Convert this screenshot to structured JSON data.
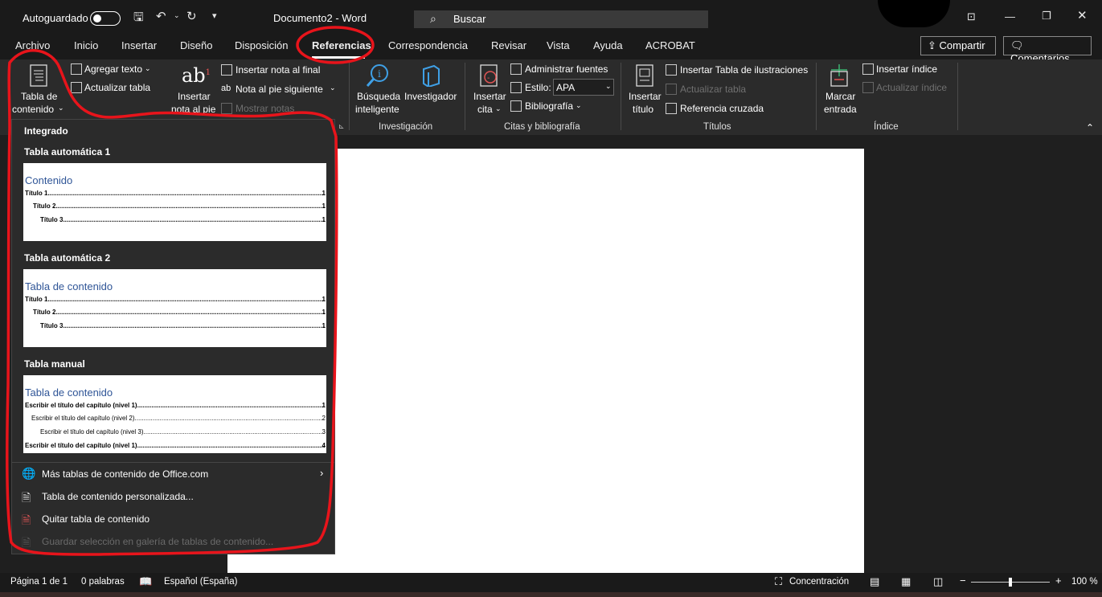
{
  "titlebar": {
    "autosave_label": "Autoguardado",
    "doc_title": "Documento2 - Word",
    "search_placeholder": "Buscar"
  },
  "tabs": [
    "Archivo",
    "Inicio",
    "Insertar",
    "Diseño",
    "Disposición",
    "Referencias",
    "Correspondencia",
    "Revisar",
    "Vista",
    "Ayuda",
    "ACROBAT"
  ],
  "active_tab": "Referencias",
  "actions": {
    "share": "Compartir",
    "comments": "Comentarios"
  },
  "ribbon": {
    "toc_l1": "Tabla de",
    "toc_l2": "contenido",
    "add_text": "Agregar texto",
    "update_table": "Actualizar tabla",
    "insert_footnote_l1": "Insertar",
    "insert_footnote_l2": "nota al pie",
    "insert_endnote": "Insertar nota al final",
    "next_footnote": "Nota al pie siguiente",
    "show_notes": "Mostrar notas",
    "smart_lookup_l1": "Búsqueda",
    "smart_lookup_l2": "inteligente",
    "researcher": "Investigador",
    "group_research": "Investigación",
    "insert_citation_l1": "Insertar",
    "insert_citation_l2": "cita",
    "manage_sources": "Administrar fuentes",
    "style_label": "Estilo:",
    "style_value": "APA",
    "bibliography": "Bibliografía",
    "group_citations": "Citas y bibliografía",
    "insert_caption_l1": "Insertar",
    "insert_caption_l2": "título",
    "insert_tof": "Insertar Tabla de ilustraciones",
    "update_table2": "Actualizar tabla",
    "cross_ref": "Referencia cruzada",
    "group_captions": "Títulos",
    "mark_entry_l1": "Marcar",
    "mark_entry_l2": "entrada",
    "insert_index": "Insertar índice",
    "update_index": "Actualizar índice",
    "group_index": "Índice"
  },
  "dropdown": {
    "section": "Integrado",
    "auto1": {
      "heading": "Tabla automática 1",
      "title": "Contenido",
      "lines": [
        {
          "text": "Título 1",
          "page": "1"
        },
        {
          "text": "Título 2",
          "page": "1"
        },
        {
          "text": "Título 3",
          "page": "1"
        }
      ]
    },
    "auto2": {
      "heading": "Tabla automática 2",
      "title": "Tabla de contenido",
      "lines": [
        {
          "text": "Título 1",
          "page": "1"
        },
        {
          "text": "Título 2",
          "page": "1"
        },
        {
          "text": "Título 3",
          "page": "1"
        }
      ]
    },
    "manual": {
      "heading": "Tabla manual",
      "title": "Tabla de contenido",
      "lines": [
        {
          "text": "Escribir el título del capítulo (nivel 1)",
          "page": "1"
        },
        {
          "text": "Escribir el título del capítulo (nivel 2)",
          "page": "2"
        },
        {
          "text": "Escribir el título del capítulo (nivel 3)",
          "page": "3"
        },
        {
          "text": "Escribir el título del capítulo (nivel 1)",
          "page": "4"
        }
      ]
    },
    "more": "Más tablas de contenido de Office.com",
    "custom": "Tabla de contenido personalizada...",
    "remove": "Quitar tabla de contenido",
    "save_sel": "Guardar selección en galería de tablas de contenido..."
  },
  "status": {
    "page": "Página 1 de 1",
    "words": "0 palabras",
    "lang": "Español (España)",
    "focus": "Concentración",
    "zoom": "100 %"
  },
  "colors": {
    "accent_red": "#e8141b",
    "toc_title_blue": "#2f5597"
  }
}
